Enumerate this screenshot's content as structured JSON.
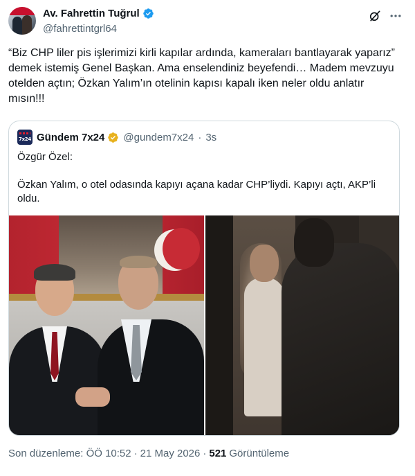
{
  "author": {
    "display_name": "Av. Fahrettin Tuğrul",
    "handle": "@fahrettintgrl64",
    "verified_color": "#1d9bf0"
  },
  "tweet_text": "“Biz CHP liler pis işlerimizi kirli kapılar ardında, kameraları bantlayarak yaparız” demek istemiş Genel Başkan. Ama enselendiniz beyefendi… Madem mevzuyu otelden açtın; Özkan Yalım’ın otelinin kapısı kapalı iken neler oldu anlatır mısın!!!",
  "quoted": {
    "avatar_text": "7x24",
    "display_name": "Gündem 7x24",
    "verified_color": "#e8b21f",
    "handle": "@gundem7x24",
    "separator": "·",
    "time": "3s",
    "text": "Özgür Özel:\n\nÖzkan Yalım, o otel odasında kapıyı açana kadar CHP’liydi. Kapıyı açtı, AKP’li oldu."
  },
  "footer": {
    "edited_label": "Son düzenleme: ÖÖ 10:52",
    "separator": "·",
    "date": "21 May 2026",
    "views_count": "521",
    "views_label": "Görüntüleme"
  },
  "icons": [
    "grok-icon",
    "more-icon",
    "verified-badge-icon"
  ]
}
